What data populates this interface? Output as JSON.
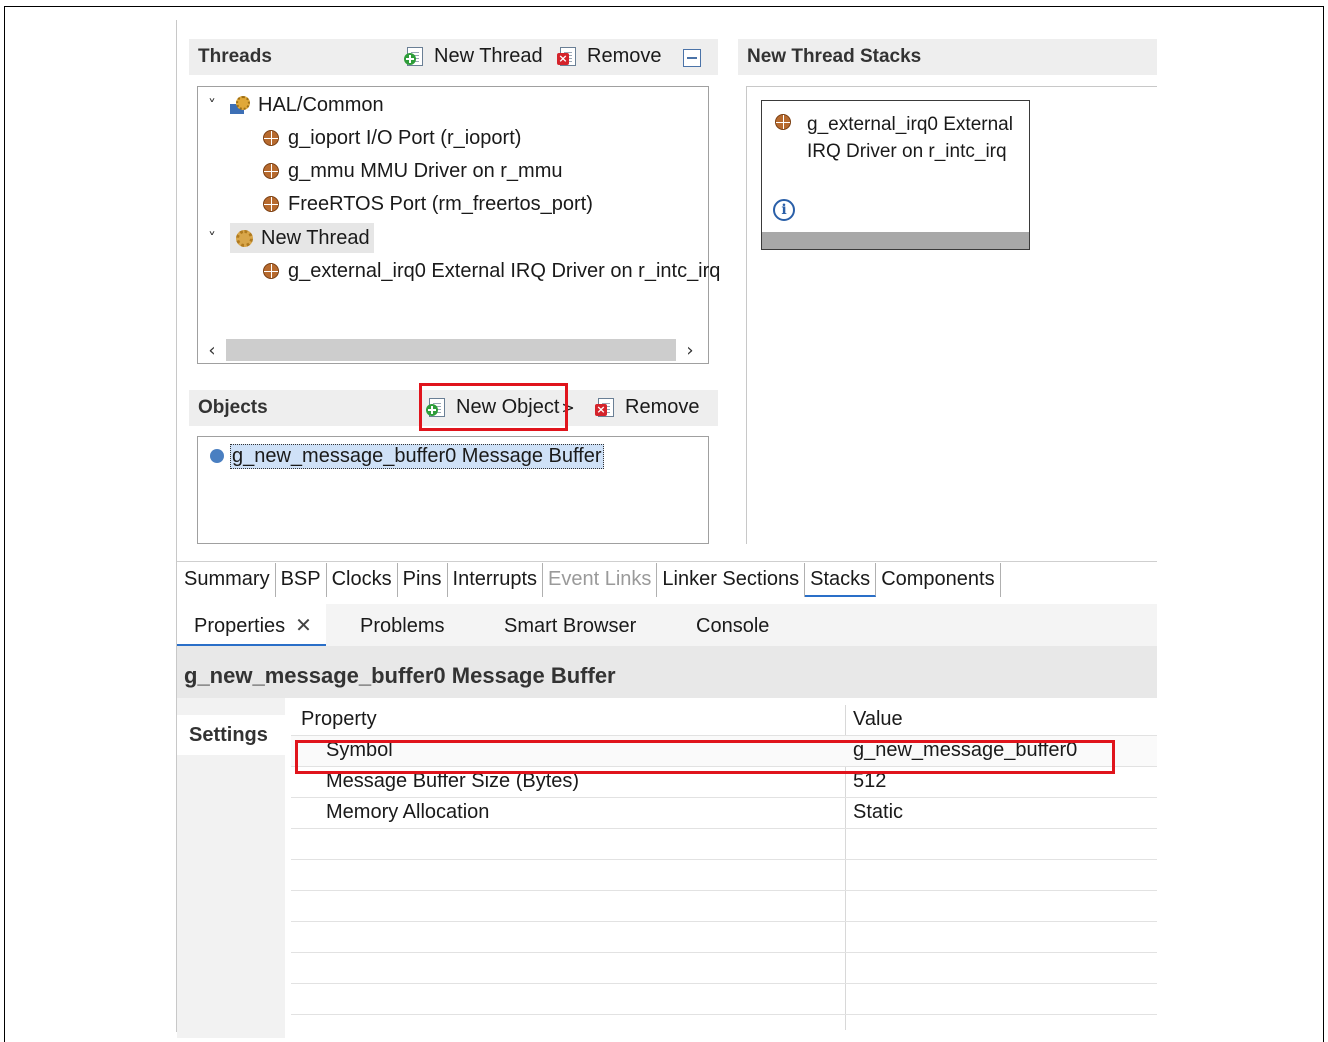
{
  "threads": {
    "title": "Threads",
    "new_thread_label": "New Thread",
    "remove_label": "Remove",
    "tree": [
      {
        "label": "HAL/Common"
      },
      {
        "label": "g_ioport I/O Port (r_ioport)"
      },
      {
        "label": "g_mmu MMU Driver on r_mmu"
      },
      {
        "label": "FreeRTOS Port (rm_freertos_port)"
      },
      {
        "label": "New Thread"
      },
      {
        "label": "g_external_irq0 External IRQ Driver on r_intc_irq"
      }
    ]
  },
  "thread_stacks": {
    "title": "New Thread Stacks",
    "block_label": "g_external_irq0 External IRQ Driver on r_intc_irq"
  },
  "objects": {
    "title": "Objects",
    "new_object_label": "New Object",
    "remove_label": "Remove",
    "items": [
      {
        "label": "g_new_message_buffer0 Message Buffer"
      }
    ]
  },
  "editor_tabs": [
    {
      "label": "Summary",
      "state": "normal"
    },
    {
      "label": "BSP",
      "state": "normal"
    },
    {
      "label": "Clocks",
      "state": "normal"
    },
    {
      "label": "Pins",
      "state": "normal"
    },
    {
      "label": "Interrupts",
      "state": "normal"
    },
    {
      "label": "Event Links",
      "state": "disabled"
    },
    {
      "label": "Linker Sections",
      "state": "normal"
    },
    {
      "label": "Stacks",
      "state": "active"
    },
    {
      "label": "Components",
      "state": "normal"
    }
  ],
  "view_tabs": [
    {
      "label": "Properties"
    },
    {
      "label": "Problems"
    },
    {
      "label": "Smart Browser"
    },
    {
      "label": "Console"
    }
  ],
  "properties": {
    "title": "g_new_message_buffer0 Message Buffer",
    "side_tab": "Settings",
    "col_property": "Property",
    "col_value": "Value",
    "rows": [
      {
        "property": "Symbol",
        "value": "g_new_message_buffer0"
      },
      {
        "property": "Message Buffer Size (Bytes)",
        "value": "512"
      },
      {
        "property": "Memory Allocation",
        "value": "Static"
      }
    ]
  },
  "colors": {
    "highlight_red": "#e0141c",
    "active_tab_blue": "#2a6fc8",
    "selection_blue": "#cfe1f7"
  }
}
